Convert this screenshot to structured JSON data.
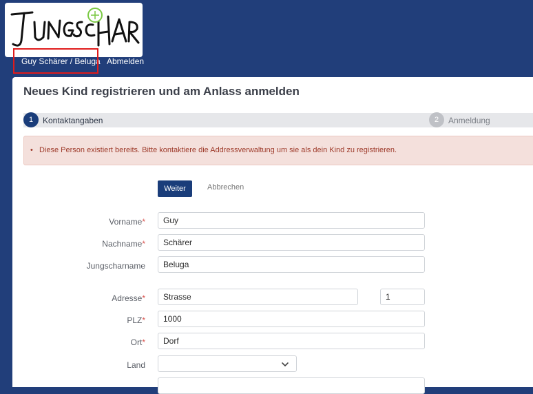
{
  "logo": {
    "text": "JUNGSCHAR"
  },
  "nav": {
    "user": "Guy Schärer / Beluga",
    "logout": "Abmelden"
  },
  "page": {
    "title": "Neues Kind registrieren und am Anlass anmelden"
  },
  "steps": [
    {
      "number": "1",
      "label": "Kontaktangaben"
    },
    {
      "number": "2",
      "label": "Anmeldung"
    }
  ],
  "alert": {
    "bullet": "•",
    "message": "Diese Person existiert bereits. Bitte kontaktiere die Addressverwaltung um sie als dein Kind zu registrieren."
  },
  "actions": {
    "next": "Weiter",
    "cancel": "Abbrechen"
  },
  "form": {
    "vorname": {
      "label": "Vorname",
      "value": "Guy",
      "required": "*"
    },
    "nachname": {
      "label": "Nachname",
      "value": "Schärer",
      "required": "*"
    },
    "jungscharname": {
      "label": "Jungscharname",
      "value": "Beluga"
    },
    "adresse": {
      "label": "Adresse",
      "street": "Strasse",
      "number": "1",
      "required": "*"
    },
    "plz": {
      "label": "PLZ",
      "value": "1000",
      "required": "*"
    },
    "ort": {
      "label": "Ort",
      "value": "Dorf",
      "required": "*"
    },
    "land": {
      "label": "Land",
      "value": ""
    }
  },
  "colors": {
    "brand": "#213e7a",
    "primary_button": "#1a3d7a",
    "alert_bg": "#f4e0dc",
    "alert_text": "#9e3b2b",
    "highlight": "#e01b1b"
  },
  "icons": {
    "dropdown": "chevron-down-icon"
  }
}
